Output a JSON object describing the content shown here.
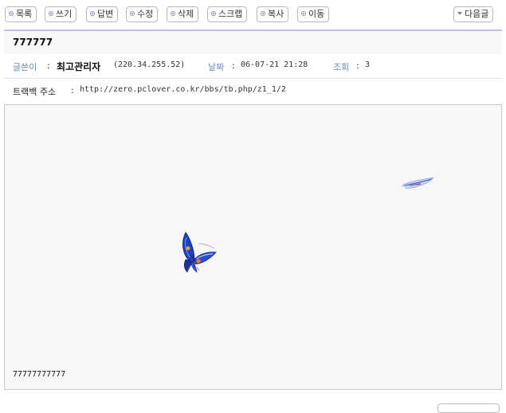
{
  "toolbar": {
    "buttons": [
      {
        "label": "목록"
      },
      {
        "label": "쓰기"
      },
      {
        "label": "답변"
      },
      {
        "label": "수정"
      },
      {
        "label": "삭제"
      },
      {
        "label": "스크랩"
      },
      {
        "label": "복사"
      },
      {
        "label": "이동"
      }
    ],
    "next_label": "다음글"
  },
  "post": {
    "title": "777777",
    "author_label": "글쓴이",
    "author_name": "최고관리자",
    "author_ip": "(220.34.255.52)",
    "date_label": "날짜",
    "date_value": "06-07-21 21:28",
    "views_label": "조회",
    "views_value": "3",
    "trackback_label": "트랙백 주소",
    "trackback_url": "http://zero.pclover.co.kr/bbs/tb.php/z1_1/2",
    "body": "77777777777"
  },
  "icons": {
    "bullet": "circle-bullet-icon",
    "next": "triangle-down-icon",
    "image_large": "butterfly-image",
    "image_small": "butterfly-image"
  },
  "colors": {
    "accent_line": "#bfbcef",
    "label": "#6c8bb7",
    "content_bg": "#f7f7f7"
  }
}
